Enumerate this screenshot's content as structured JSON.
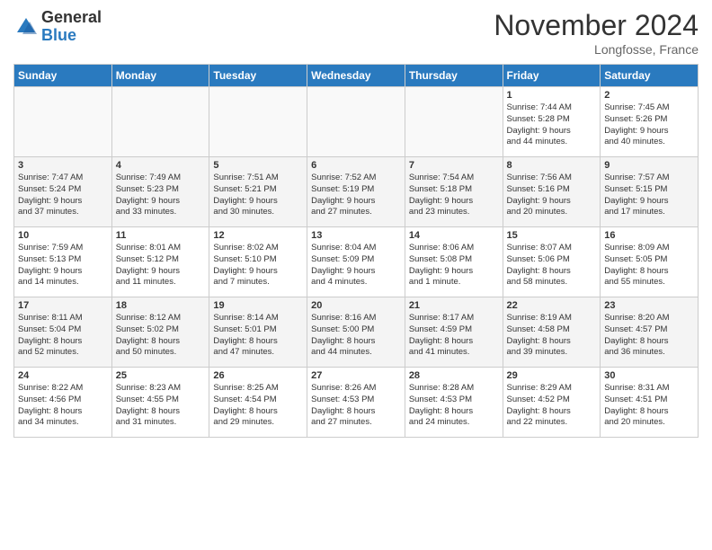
{
  "header": {
    "logo_general": "General",
    "logo_blue": "Blue",
    "month_title": "November 2024",
    "location": "Longfosse, France"
  },
  "weekdays": [
    "Sunday",
    "Monday",
    "Tuesday",
    "Wednesday",
    "Thursday",
    "Friday",
    "Saturday"
  ],
  "weeks": [
    [
      {
        "day": "",
        "info": ""
      },
      {
        "day": "",
        "info": ""
      },
      {
        "day": "",
        "info": ""
      },
      {
        "day": "",
        "info": ""
      },
      {
        "day": "",
        "info": ""
      },
      {
        "day": "1",
        "info": "Sunrise: 7:44 AM\nSunset: 5:28 PM\nDaylight: 9 hours\nand 44 minutes."
      },
      {
        "day": "2",
        "info": "Sunrise: 7:45 AM\nSunset: 5:26 PM\nDaylight: 9 hours\nand 40 minutes."
      }
    ],
    [
      {
        "day": "3",
        "info": "Sunrise: 7:47 AM\nSunset: 5:24 PM\nDaylight: 9 hours\nand 37 minutes."
      },
      {
        "day": "4",
        "info": "Sunrise: 7:49 AM\nSunset: 5:23 PM\nDaylight: 9 hours\nand 33 minutes."
      },
      {
        "day": "5",
        "info": "Sunrise: 7:51 AM\nSunset: 5:21 PM\nDaylight: 9 hours\nand 30 minutes."
      },
      {
        "day": "6",
        "info": "Sunrise: 7:52 AM\nSunset: 5:19 PM\nDaylight: 9 hours\nand 27 minutes."
      },
      {
        "day": "7",
        "info": "Sunrise: 7:54 AM\nSunset: 5:18 PM\nDaylight: 9 hours\nand 23 minutes."
      },
      {
        "day": "8",
        "info": "Sunrise: 7:56 AM\nSunset: 5:16 PM\nDaylight: 9 hours\nand 20 minutes."
      },
      {
        "day": "9",
        "info": "Sunrise: 7:57 AM\nSunset: 5:15 PM\nDaylight: 9 hours\nand 17 minutes."
      }
    ],
    [
      {
        "day": "10",
        "info": "Sunrise: 7:59 AM\nSunset: 5:13 PM\nDaylight: 9 hours\nand 14 minutes."
      },
      {
        "day": "11",
        "info": "Sunrise: 8:01 AM\nSunset: 5:12 PM\nDaylight: 9 hours\nand 11 minutes."
      },
      {
        "day": "12",
        "info": "Sunrise: 8:02 AM\nSunset: 5:10 PM\nDaylight: 9 hours\nand 7 minutes."
      },
      {
        "day": "13",
        "info": "Sunrise: 8:04 AM\nSunset: 5:09 PM\nDaylight: 9 hours\nand 4 minutes."
      },
      {
        "day": "14",
        "info": "Sunrise: 8:06 AM\nSunset: 5:08 PM\nDaylight: 9 hours\nand 1 minute."
      },
      {
        "day": "15",
        "info": "Sunrise: 8:07 AM\nSunset: 5:06 PM\nDaylight: 8 hours\nand 58 minutes."
      },
      {
        "day": "16",
        "info": "Sunrise: 8:09 AM\nSunset: 5:05 PM\nDaylight: 8 hours\nand 55 minutes."
      }
    ],
    [
      {
        "day": "17",
        "info": "Sunrise: 8:11 AM\nSunset: 5:04 PM\nDaylight: 8 hours\nand 52 minutes."
      },
      {
        "day": "18",
        "info": "Sunrise: 8:12 AM\nSunset: 5:02 PM\nDaylight: 8 hours\nand 50 minutes."
      },
      {
        "day": "19",
        "info": "Sunrise: 8:14 AM\nSunset: 5:01 PM\nDaylight: 8 hours\nand 47 minutes."
      },
      {
        "day": "20",
        "info": "Sunrise: 8:16 AM\nSunset: 5:00 PM\nDaylight: 8 hours\nand 44 minutes."
      },
      {
        "day": "21",
        "info": "Sunrise: 8:17 AM\nSunset: 4:59 PM\nDaylight: 8 hours\nand 41 minutes."
      },
      {
        "day": "22",
        "info": "Sunrise: 8:19 AM\nSunset: 4:58 PM\nDaylight: 8 hours\nand 39 minutes."
      },
      {
        "day": "23",
        "info": "Sunrise: 8:20 AM\nSunset: 4:57 PM\nDaylight: 8 hours\nand 36 minutes."
      }
    ],
    [
      {
        "day": "24",
        "info": "Sunrise: 8:22 AM\nSunset: 4:56 PM\nDaylight: 8 hours\nand 34 minutes."
      },
      {
        "day": "25",
        "info": "Sunrise: 8:23 AM\nSunset: 4:55 PM\nDaylight: 8 hours\nand 31 minutes."
      },
      {
        "day": "26",
        "info": "Sunrise: 8:25 AM\nSunset: 4:54 PM\nDaylight: 8 hours\nand 29 minutes."
      },
      {
        "day": "27",
        "info": "Sunrise: 8:26 AM\nSunset: 4:53 PM\nDaylight: 8 hours\nand 27 minutes."
      },
      {
        "day": "28",
        "info": "Sunrise: 8:28 AM\nSunset: 4:53 PM\nDaylight: 8 hours\nand 24 minutes."
      },
      {
        "day": "29",
        "info": "Sunrise: 8:29 AM\nSunset: 4:52 PM\nDaylight: 8 hours\nand 22 minutes."
      },
      {
        "day": "30",
        "info": "Sunrise: 8:31 AM\nSunset: 4:51 PM\nDaylight: 8 hours\nand 20 minutes."
      }
    ]
  ]
}
